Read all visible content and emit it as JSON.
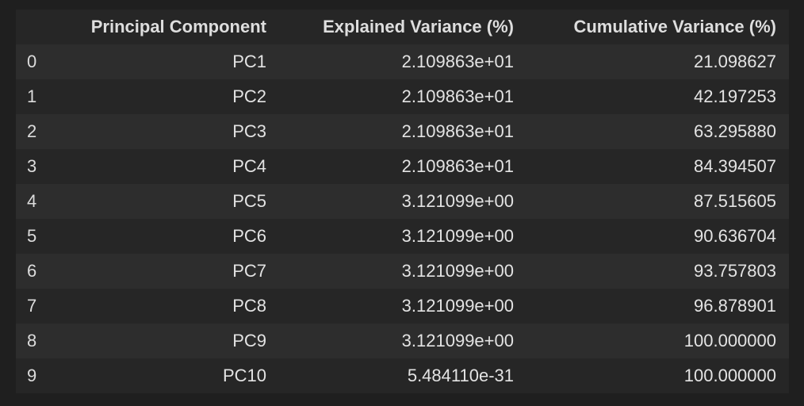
{
  "table": {
    "columns": [
      "",
      "Principal Component",
      "Explained Variance (%)",
      "Cumulative Variance (%)"
    ],
    "rows": [
      {
        "index": "0",
        "pc": "PC1",
        "explained": "2.109863e+01",
        "cumulative": "21.098627"
      },
      {
        "index": "1",
        "pc": "PC2",
        "explained": "2.109863e+01",
        "cumulative": "42.197253"
      },
      {
        "index": "2",
        "pc": "PC3",
        "explained": "2.109863e+01",
        "cumulative": "63.295880"
      },
      {
        "index": "3",
        "pc": "PC4",
        "explained": "2.109863e+01",
        "cumulative": "84.394507"
      },
      {
        "index": "4",
        "pc": "PC5",
        "explained": "3.121099e+00",
        "cumulative": "87.515605"
      },
      {
        "index": "5",
        "pc": "PC6",
        "explained": "3.121099e+00",
        "cumulative": "90.636704"
      },
      {
        "index": "6",
        "pc": "PC7",
        "explained": "3.121099e+00",
        "cumulative": "93.757803"
      },
      {
        "index": "7",
        "pc": "PC8",
        "explained": "3.121099e+00",
        "cumulative": "96.878901"
      },
      {
        "index": "8",
        "pc": "PC9",
        "explained": "3.121099e+00",
        "cumulative": "100.000000"
      },
      {
        "index": "9",
        "pc": "PC10",
        "explained": "5.484110e-31",
        "cumulative": "100.000000"
      }
    ]
  },
  "colors": {
    "background": "#1f1f1f",
    "header_bg": "#262626",
    "row_odd": "#2d2d2d",
    "row_even": "#262626",
    "text": "#e3e3e3"
  }
}
